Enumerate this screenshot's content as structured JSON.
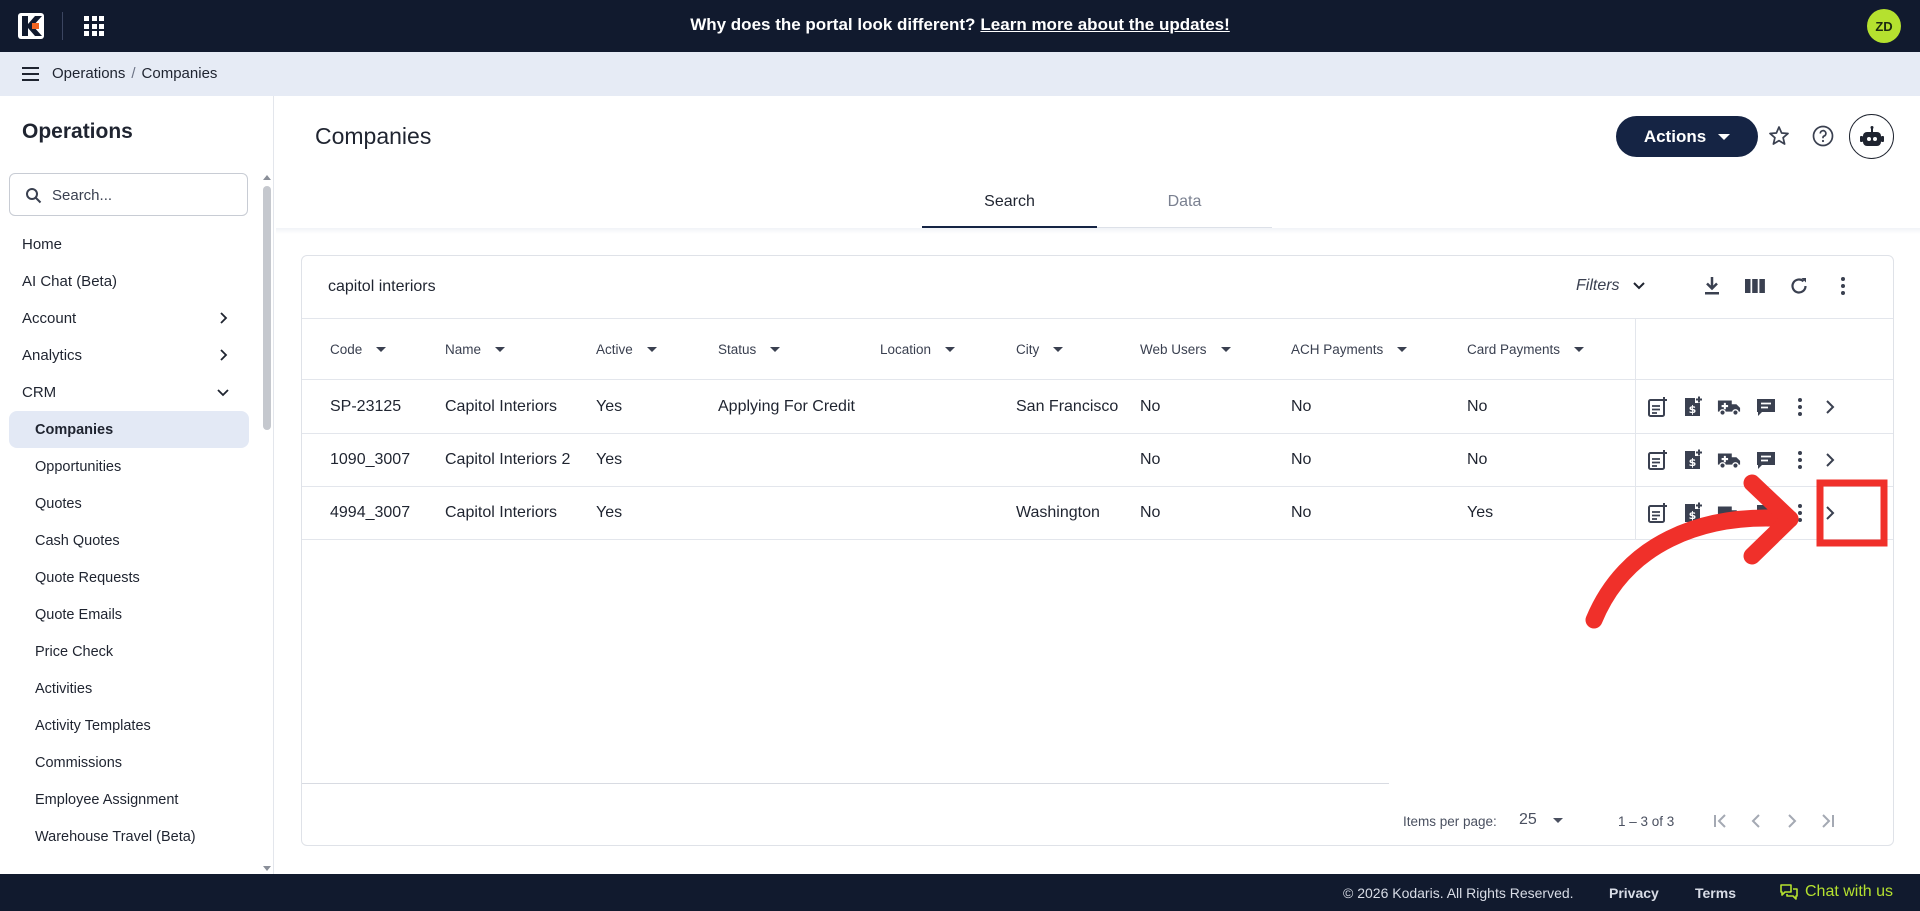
{
  "topbar": {
    "banner_text": "Why does the portal look different?",
    "banner_link": "Learn more about the updates!",
    "avatar_initials": "ZD"
  },
  "breadcrumb": {
    "parent": "Operations",
    "current": "Companies"
  },
  "sidebar": {
    "title": "Operations",
    "search_placeholder": "Search...",
    "items": [
      {
        "label": "Home"
      },
      {
        "label": "AI Chat (Beta)"
      },
      {
        "label": "Account"
      },
      {
        "label": "Analytics"
      },
      {
        "label": "CRM"
      }
    ],
    "crm_children": [
      "Companies",
      "Opportunities",
      "Quotes",
      "Cash Quotes",
      "Quote Requests",
      "Quote Emails",
      "Price Check",
      "Activities",
      "Activity Templates",
      "Commissions",
      "Employee Assignment",
      "Warehouse Travel (Beta)"
    ],
    "active_item": "Companies"
  },
  "page": {
    "title": "Companies",
    "actions_label": "Actions"
  },
  "tabs": [
    {
      "label": "Search"
    },
    {
      "label": "Data"
    }
  ],
  "search": {
    "query": "capitol interiors",
    "filters_label": "Filters"
  },
  "table": {
    "columns": [
      "Code",
      "Name",
      "Active",
      "Status",
      "Location",
      "City",
      "Web Users",
      "ACH Payments",
      "Card Payments"
    ],
    "rows": [
      [
        "SP-23125",
        "Capitol Interiors",
        "Yes",
        "Applying For Credit",
        "",
        "San Francisco",
        "No",
        "No",
        "No"
      ],
      [
        "1090_3007",
        "Capitol Interiors 2",
        "Yes",
        "",
        "",
        "",
        "No",
        "No",
        "No"
      ],
      [
        "4994_3007",
        "Capitol Interiors",
        "Yes",
        "",
        "",
        "Washington",
        "No",
        "No",
        "Yes"
      ]
    ]
  },
  "pagination": {
    "items_per_page_label": "Items per page:",
    "page_size": "25",
    "range": "1 – 3 of 3"
  },
  "footer": {
    "copyright": "© 2026 Kodaris. All Rights Reserved.",
    "privacy": "Privacy",
    "terms": "Terms",
    "chat": "Chat with us"
  },
  "annotation": {
    "color": "#f0302a",
    "highlighted_target": "row 3 open-details chevron"
  },
  "colors": {
    "navy": "#111a2e",
    "accent_lime": "#b5e12f",
    "actions_button": "#152444"
  }
}
